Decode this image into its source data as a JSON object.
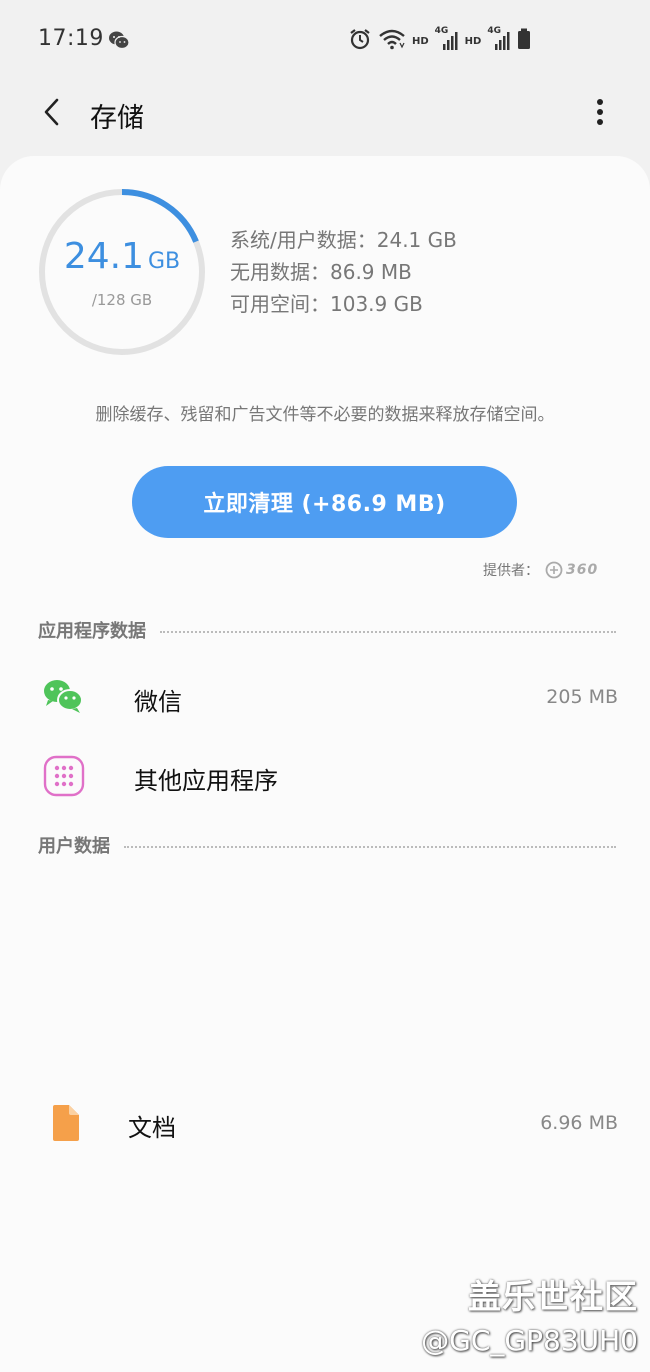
{
  "status_bar": {
    "time": "17:19",
    "network_label_1": "HD",
    "network_gen_1": "4G",
    "network_label_2": "HD",
    "network_gen_2": "4G"
  },
  "header": {
    "title": "存储"
  },
  "storage": {
    "used_value": "24.1",
    "used_unit": "GB",
    "total": "/128 GB",
    "used_fraction": 0.188,
    "stats": [
      {
        "label": "系统/用户数据：",
        "value": "24.1 GB"
      },
      {
        "label": "无用数据：",
        "value": "86.9 MB"
      },
      {
        "label": "可用空间：",
        "value": "103.9 GB"
      }
    ],
    "description": "删除缓存、残留和广告文件等不必要的数据来释放存储空间。",
    "clean_button_label": "立即清理 (+86.9 MB)",
    "provider_label": "提供者：",
    "provider_logo_text": "360"
  },
  "sections": {
    "app_data": {
      "title": "应用程序数据",
      "items": [
        {
          "name": "微信",
          "size": "205 MB",
          "icon": "wechat-icon"
        },
        {
          "name": "其他应用程序",
          "size": "",
          "icon": "apps-grid-icon"
        }
      ]
    },
    "user_data": {
      "title": "用户数据",
      "items": [
        {
          "name": "文档",
          "size": "6.96 MB",
          "icon": "document-icon"
        }
      ]
    }
  },
  "watermark": {
    "line1": "盖乐世社区",
    "line2": "@GC_GP83UH0"
  },
  "colors": {
    "accent": "#4e9df2",
    "ring_progress": "#3d8fe0",
    "ring_track": "#e2e2e2",
    "wechat_green": "#4fc45a",
    "apps_pink": "#e070c8",
    "document_orange": "#f5a04a"
  }
}
